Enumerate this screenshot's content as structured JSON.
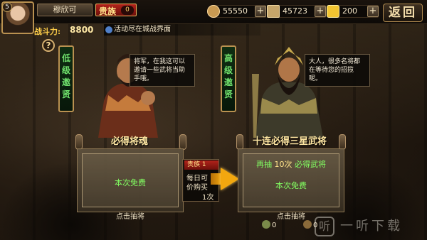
{
  "player": {
    "level": "5",
    "name": "穆欣可",
    "vip_label": "贵族",
    "vip_level": "0"
  },
  "power": {
    "label": "战斗力:",
    "value": "8800"
  },
  "tip": "活动尽在城战界面",
  "resources": [
    {
      "icon": "copper-coin-icon",
      "value": "55550",
      "color": "#c99a52"
    },
    {
      "icon": "scroll-icon",
      "value": "45723",
      "color": "#c6a66a"
    },
    {
      "icon": "gold-ingot-icon",
      "value": "200",
      "color": "#f2c531"
    }
  ],
  "back_label": "返回",
  "help_label": "?",
  "left_panel": {
    "banner": "低级邀贤",
    "speech": "将军，在我这可以邀请一些武将当助手哦。",
    "title": "必得将魂",
    "free_label": "本次免费",
    "action_label": "点击抽将",
    "owned_count": "0"
  },
  "right_panel": {
    "banner": "高级邀贤",
    "speech": "大人，很多名将都在等待您的招揽呢。",
    "title": "十连必得三星武将",
    "retry_prefix": "再抽",
    "retry_count": "10次",
    "retry_suffix": "必得武将",
    "free_label": "本次免费",
    "action_label": "点击抽将",
    "owned_count": "0"
  },
  "offer": {
    "tag": "贵族 1",
    "line1": "每日可",
    "line2": "价购买",
    "line3": "1次"
  },
  "watermark": {
    "logo": "听",
    "text": "一听下载"
  },
  "colors": {
    "accent_gold": "#ffcf4a",
    "free_green": "#82ff62",
    "banner_green": "#6fe06c",
    "vip_red": "#b2231b"
  }
}
